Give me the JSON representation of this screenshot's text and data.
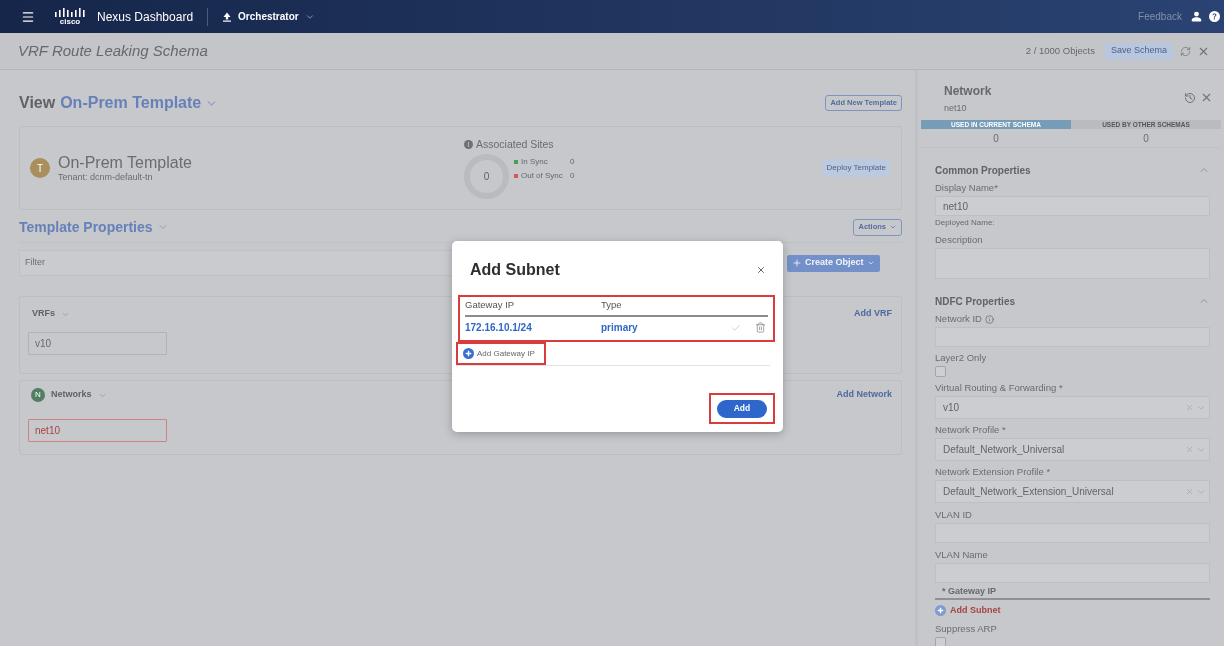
{
  "header": {
    "logo_text": "cisco",
    "product": "Nexus Dashboard",
    "app": "Orchestrator",
    "feedback": "Feedback"
  },
  "schema_bar": {
    "title": "VRF Route Leaking Schema",
    "object_count": "2 / 1000 Objects",
    "save_button": {
      "label": "Save Schema",
      "disabled": true
    }
  },
  "view": {
    "label": "View",
    "template": "On-Prem Template",
    "add_button": "Add New Template"
  },
  "template_card": {
    "avatar": "T",
    "name": "On-Prem Template",
    "tenant": "Tenant: dcnm-default-tn",
    "associated_sites": {
      "title": "Associated Sites",
      "total": "0",
      "legend": [
        {
          "label": "In Sync",
          "count": "0",
          "color": "#4e9a5b"
        },
        {
          "label": "Out of Sync",
          "count": "0",
          "color": "#d35b5b"
        }
      ]
    },
    "deploy_button": {
      "label": "Deploy Template",
      "disabled": true
    }
  },
  "template_properties": {
    "title": "Template Properties",
    "actions_button": "Actions",
    "filter": {
      "placeholder": "Filter"
    },
    "create_button": "Create Object"
  },
  "sections": [
    {
      "title": "VRFs",
      "add_link": "Add VRF",
      "items": [
        {
          "label": "v10",
          "invalid": false
        }
      ]
    },
    {
      "title": "Networks",
      "badge": "N",
      "add_link": "Add Network",
      "items": [
        {
          "label": "net10",
          "invalid": true
        }
      ]
    }
  ],
  "dialog": {
    "title": "Add Subnet",
    "table": {
      "columns": [
        "Gateway IP",
        "Type"
      ],
      "rows": [
        {
          "gateway_ip": "172.16.10.1/24",
          "type": "primary"
        }
      ],
      "highlighted": true
    },
    "add_row": {
      "label": "Add Gateway IP",
      "highlighted": true
    },
    "submit": {
      "label": "Add",
      "highlighted": true
    }
  },
  "panel": {
    "title": "Network",
    "subtitle": "net10",
    "usage": [
      {
        "label": "USED IN CURRENT SCHEMA",
        "count": "0",
        "selected": true
      },
      {
        "label": "USED BY OTHER SCHEMAS",
        "count": "0",
        "selected": false
      }
    ],
    "groups": [
      {
        "title": "Common Properties",
        "expanded": true,
        "fields": [
          {
            "kind": "text",
            "label": "Display Name*",
            "value": "net10"
          },
          {
            "kind": "note",
            "label": "Deployed Name:"
          },
          {
            "kind": "textarea",
            "label": "Description"
          }
        ]
      },
      {
        "title": "NDFC Properties",
        "expanded": true,
        "fields": [
          {
            "kind": "text",
            "label": "Network ID",
            "info": true
          },
          {
            "kind": "checkbox",
            "label": "Layer2 Only",
            "checked": false
          },
          {
            "kind": "select",
            "label": "Virtual Routing & Forwarding *",
            "value": "v10"
          },
          {
            "kind": "select",
            "label": "Network Profile *",
            "value": "Default_Network_Universal"
          },
          {
            "kind": "select",
            "label": "Network Extension Profile *",
            "value": "Default_Network_Extension_Universal"
          },
          {
            "kind": "text",
            "label": "VLAN ID"
          },
          {
            "kind": "text",
            "label": "VLAN Name"
          },
          {
            "kind": "subnets",
            "header": "* Gateway IP",
            "add_label": "Add Subnet"
          },
          {
            "kind": "checkbox",
            "label": "Suppress ARP",
            "checked": false
          }
        ]
      }
    ]
  }
}
